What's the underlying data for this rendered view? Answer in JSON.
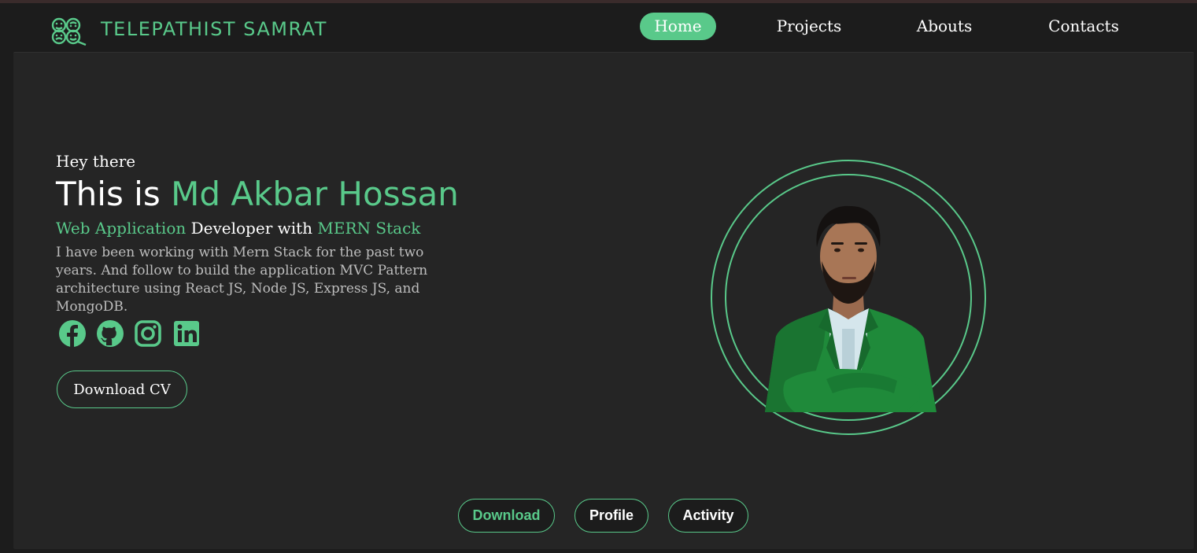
{
  "brand": {
    "name": "TELEPATHIST SAMRAT",
    "logo_icon": "faces-logo-icon",
    "accent": "#59c98a"
  },
  "nav": {
    "items": [
      {
        "label": "Home",
        "active": true
      },
      {
        "label": "Projects",
        "active": false
      },
      {
        "label": "Abouts",
        "active": false
      },
      {
        "label": "Contacts",
        "active": false
      }
    ]
  },
  "hero": {
    "greeting": "Hey there",
    "title_prefix": "This is",
    "name": "Md Akbar Hossan",
    "role_part1": "Web Application",
    "role_part2": "Developer with",
    "role_part3": "MERN Stack",
    "description": "I have been working with Mern Stack for the past two years. And follow to build the application MVC Pattern architecture using React JS, Node JS, Express JS, and MongoDB.",
    "cv_button": "Download CV",
    "social_icons": [
      "facebook-icon",
      "github-icon",
      "instagram-icon",
      "linkedin-icon"
    ]
  },
  "tabs": {
    "download": "Download",
    "profile": "Profile",
    "activity": "Activity"
  },
  "colors": {
    "background": "#1c1c1c",
    "card": "#252525",
    "accent": "#59c98a",
    "text": "#ffffff",
    "muted_text": "#bdbdbd"
  }
}
